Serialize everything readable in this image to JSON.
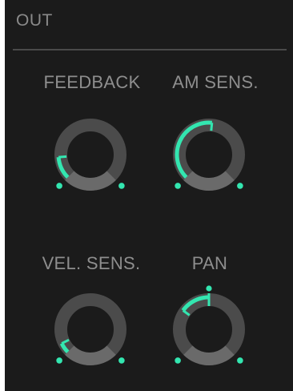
{
  "section": {
    "title": "OUT"
  },
  "colors": {
    "panel_bg": "#1b1b1b",
    "accent": "#33e6b0",
    "track_dark": "#4b4b4b",
    "track_light": "#6a6a6a",
    "label": "#8e8e8e"
  },
  "knobs": [
    {
      "id": "feedback",
      "label": "FEEDBACK",
      "value": 0.15,
      "bipolar": false
    },
    {
      "id": "am-sens",
      "label": "AM SENS.",
      "value": 0.52,
      "bipolar": false
    },
    {
      "id": "vel-sens",
      "label": "VEL. SENS.",
      "value": 0.07,
      "bipolar": false
    },
    {
      "id": "pan",
      "label": "PAN",
      "value": 0.3,
      "bipolar": true
    }
  ]
}
